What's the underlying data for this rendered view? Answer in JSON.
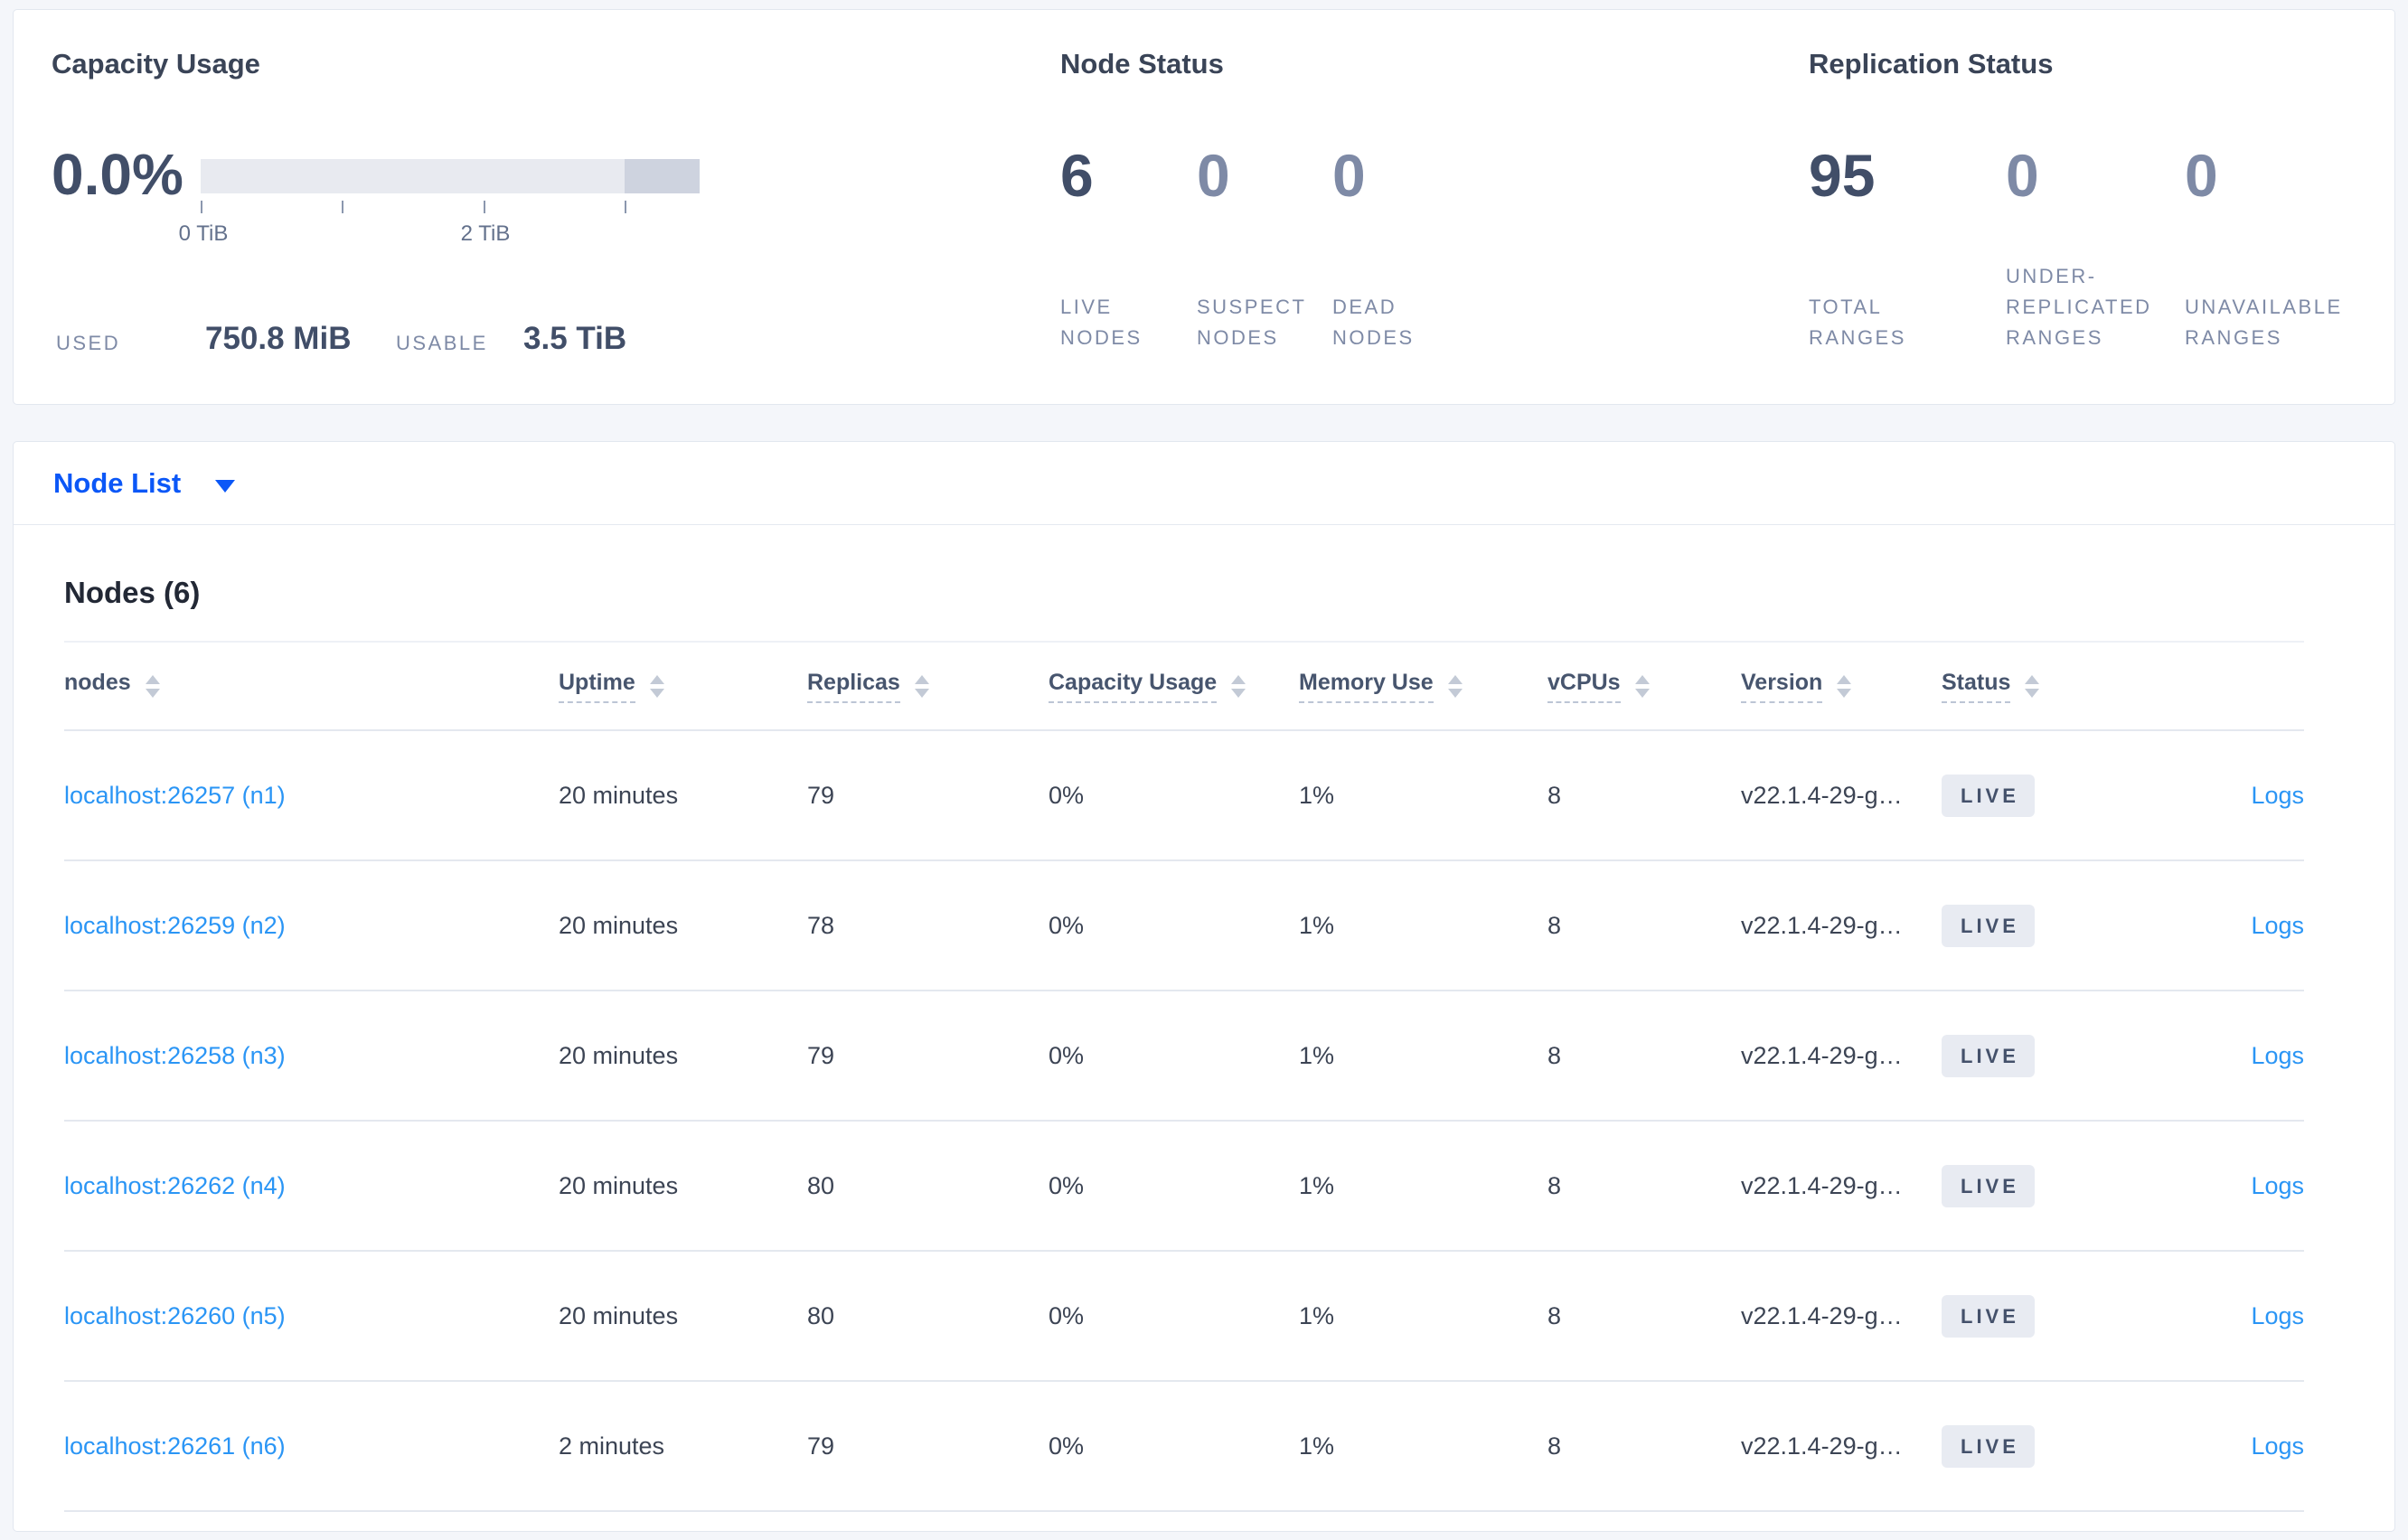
{
  "summary": {
    "capacity": {
      "title": "Capacity Usage",
      "percent": "0.0%",
      "tick_labels": [
        "0 TiB",
        "2 TiB"
      ],
      "used_label": "USED",
      "used_value": "750.8 MiB",
      "usable_label": "USABLE",
      "usable_value": "3.5 TiB"
    },
    "node_status": {
      "title": "Node Status",
      "stats": [
        {
          "value": "6",
          "label": "LIVE NODES"
        },
        {
          "value": "0",
          "label": "SUSPECT NODES"
        },
        {
          "value": "0",
          "label": "DEAD NODES"
        }
      ]
    },
    "replication": {
      "title": "Replication Status",
      "stats": [
        {
          "value": "95",
          "label": "TOTAL RANGES"
        },
        {
          "value": "0",
          "label": "UNDER-REPLICATED RANGES"
        },
        {
          "value": "0",
          "label": "UNAVAILABLE RANGES"
        }
      ]
    }
  },
  "view_selector": {
    "label": "Node List",
    "icon": "caret-down-icon"
  },
  "table": {
    "title": "Nodes (6)",
    "columns": [
      {
        "label": "nodes"
      },
      {
        "label": "Uptime"
      },
      {
        "label": "Replicas"
      },
      {
        "label": "Capacity Usage"
      },
      {
        "label": "Memory Use"
      },
      {
        "label": "vCPUs"
      },
      {
        "label": "Version"
      },
      {
        "label": "Status"
      },
      {
        "label": ""
      }
    ],
    "rows": [
      {
        "node": "localhost:26257 (n1)",
        "uptime": "20 minutes",
        "replicas": "79",
        "capacity": "0%",
        "memory": "1%",
        "vcpus": "8",
        "version": "v22.1.4-29-g…",
        "status": "LIVE",
        "logs": "Logs"
      },
      {
        "node": "localhost:26259 (n2)",
        "uptime": "20 minutes",
        "replicas": "78",
        "capacity": "0%",
        "memory": "1%",
        "vcpus": "8",
        "version": "v22.1.4-29-g…",
        "status": "LIVE",
        "logs": "Logs"
      },
      {
        "node": "localhost:26258 (n3)",
        "uptime": "20 minutes",
        "replicas": "79",
        "capacity": "0%",
        "memory": "1%",
        "vcpus": "8",
        "version": "v22.1.4-29-g…",
        "status": "LIVE",
        "logs": "Logs"
      },
      {
        "node": "localhost:26262 (n4)",
        "uptime": "20 minutes",
        "replicas": "80",
        "capacity": "0%",
        "memory": "1%",
        "vcpus": "8",
        "version": "v22.1.4-29-g…",
        "status": "LIVE",
        "logs": "Logs"
      },
      {
        "node": "localhost:26260 (n5)",
        "uptime": "20 minutes",
        "replicas": "80",
        "capacity": "0%",
        "memory": "1%",
        "vcpus": "8",
        "version": "v22.1.4-29-g…",
        "status": "LIVE",
        "logs": "Logs"
      },
      {
        "node": "localhost:26261 (n6)",
        "uptime": "2 minutes",
        "replicas": "79",
        "capacity": "0%",
        "memory": "1%",
        "vcpus": "8",
        "version": "v22.1.4-29-g…",
        "status": "LIVE",
        "logs": "Logs"
      }
    ]
  },
  "colors": {
    "accent_blue": "#0b57f7",
    "link_blue": "#2a95f5",
    "bar_light": "#e8eaf0",
    "bar_dark": "#ced3df",
    "badge_bg": "#e8ebf2"
  }
}
